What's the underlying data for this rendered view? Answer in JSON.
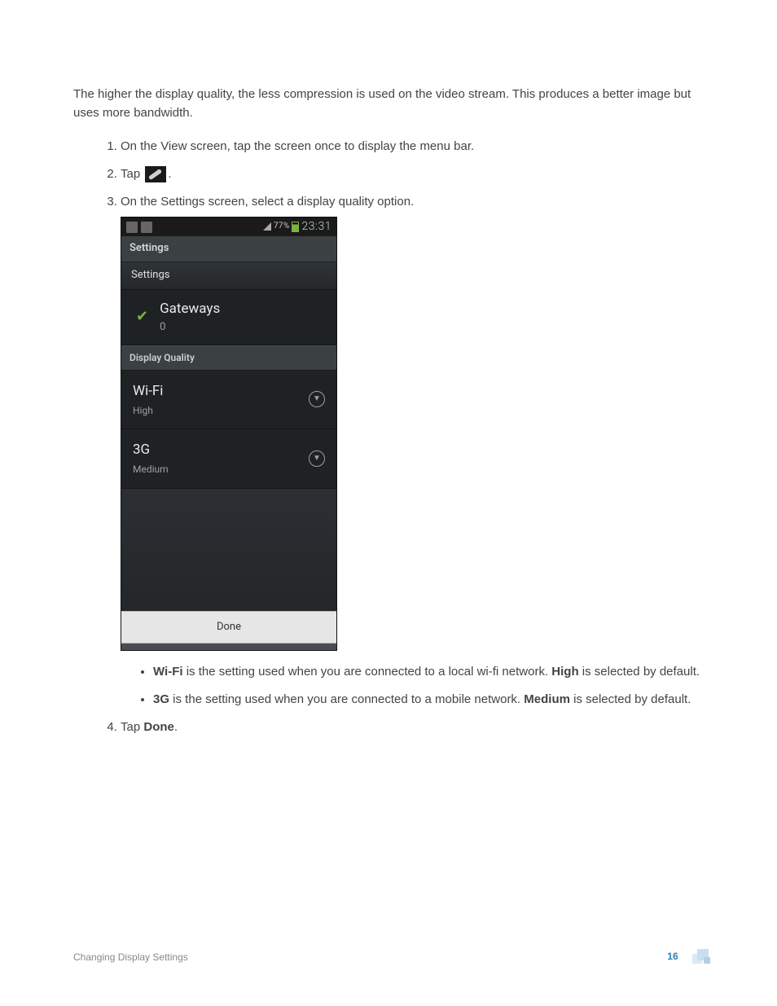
{
  "intro": "The higher the display quality, the less compression is used on the video stream. This produces a better image but uses more bandwidth.",
  "steps": {
    "s1": "On the View screen, tap the screen once to display the menu bar.",
    "s2_pre": "Tap ",
    "s2_post": ".",
    "s3": "On the Settings screen, select a display quality option.",
    "s4_pre": "Tap ",
    "s4_bold": "Done",
    "s4_post": "."
  },
  "phone": {
    "status_pct": "77%",
    "status_time": "23:31",
    "title1": "Settings",
    "title2": "Settings",
    "gateways_label": "Gateways",
    "gateways_count": "0",
    "dq_header": "Display Quality",
    "rows": [
      {
        "label": "Wi-Fi",
        "sub": "High"
      },
      {
        "label": "3G",
        "sub": "Medium"
      }
    ],
    "done": "Done"
  },
  "bullets": {
    "wifi_b": "Wi-Fi",
    "wifi_mid": " is the setting used when you are connected to a local wi-fi network. ",
    "wifi_b2": "High",
    "wifi_post": " is selected by default.",
    "g3_b": "3G",
    "g3_mid": " is the setting used when you are connected to a mobile network. ",
    "g3_b2": "Medium",
    "g3_post": " is selected by default."
  },
  "footer": {
    "section": "Changing Display Settings",
    "page": "16"
  }
}
